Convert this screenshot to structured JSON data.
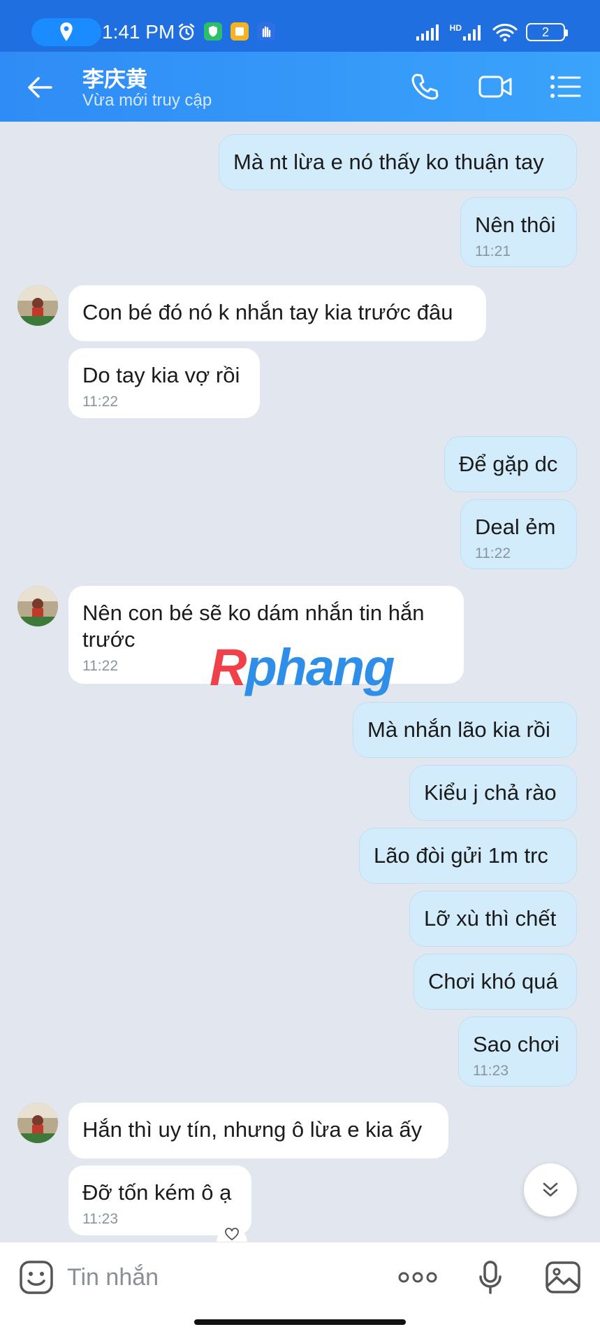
{
  "status_bar": {
    "time": "1:41 PM",
    "battery": "2",
    "network": "HD",
    "icons": [
      "location-icon",
      "alarm-icon",
      "shield-app-icon",
      "notes-app-icon",
      "hand-app-icon",
      "signal-icon",
      "wifi-icon",
      "battery-icon"
    ]
  },
  "header": {
    "contact_name": "李庆黄",
    "contact_status": "Vừa mới truy cập",
    "icons": [
      "back-arrow-icon",
      "phone-icon",
      "video-call-icon",
      "menu-list-icon"
    ]
  },
  "messages": [
    {
      "dir": "out",
      "text": "Mà nt lừa e nó thấy ko thuận tay",
      "time": ""
    },
    {
      "dir": "out",
      "text": "Nên thôi",
      "time": "11:21"
    },
    {
      "dir": "in",
      "text": "Con bé đó nó k nhắn tay kia trước đâu",
      "time": ""
    },
    {
      "dir": "in",
      "text": "Do tay kia vợ rồi",
      "time": "11:22"
    },
    {
      "dir": "out",
      "text": "Để gặp dc",
      "time": ""
    },
    {
      "dir": "out",
      "text": "Deal ẻm",
      "time": "11:22"
    },
    {
      "dir": "in",
      "text": "Nên con bé sẽ ko dám nhắn tin hắn trước",
      "time": "11:22"
    },
    {
      "dir": "out",
      "text": "Mà nhắn lão kia rồi",
      "time": ""
    },
    {
      "dir": "out",
      "text": "Kiểu j chả rào",
      "time": ""
    },
    {
      "dir": "out",
      "text": "Lão đòi gửi 1m trc",
      "time": ""
    },
    {
      "dir": "out",
      "text": "Lỡ xù thì chết",
      "time": ""
    },
    {
      "dir": "out",
      "text": "Chơi khó quá",
      "time": ""
    },
    {
      "dir": "out",
      "text": "Sao chơi",
      "time": "11:23"
    },
    {
      "dir": "in",
      "text": "Hắn thì uy tín, nhưng ô lừa e kia ấy",
      "time": ""
    },
    {
      "dir": "in",
      "text": "Đỡ tốn kém ô ạ",
      "time": "11:23"
    }
  ],
  "watermark": {
    "first": "R",
    "rest": "phang"
  },
  "input_bar": {
    "placeholder": "Tin nhắn",
    "value": "",
    "icons": [
      "sticker-icon",
      "more-icon",
      "microphone-icon",
      "image-icon"
    ]
  },
  "controls": {
    "scroll_down_icon": "double-chevron-down-icon",
    "reaction_icon": "heart-icon"
  },
  "colors": {
    "status_bar": "#1f6fe0",
    "header_start": "#2f8cf6",
    "header_end": "#3aa3fb",
    "chat_bg": "#e2e7ef",
    "outgoing_bubble": "#d3ecfb",
    "incoming_bubble": "#ffffff",
    "timestamp": "#8a949e"
  }
}
